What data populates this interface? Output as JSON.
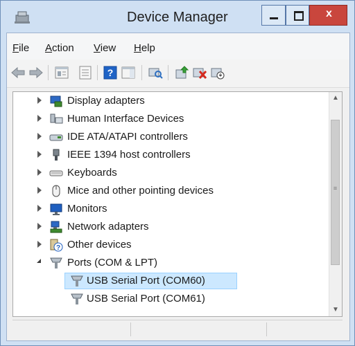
{
  "window": {
    "title": "Device Manager",
    "close_glyph": "x"
  },
  "menu": {
    "items": [
      {
        "label": "File",
        "underline": "F",
        "rest": "ile"
      },
      {
        "label": "Action",
        "underline": "A",
        "rest": "ction"
      },
      {
        "label": "View",
        "underline": "V",
        "rest": "iew"
      },
      {
        "label": "Help",
        "underline": "H",
        "rest": "elp"
      }
    ]
  },
  "toolbar": {
    "buttons": [
      "back-arrow-icon",
      "forward-arrow-icon",
      "properties-window-icon",
      "show-hidden-icon",
      "help-icon",
      "action-pane-icon",
      "scan-hardware-icon",
      "update-driver-icon",
      "uninstall-device-icon",
      "disable-device-icon"
    ]
  },
  "tree": {
    "items": [
      {
        "label": "Display adapters",
        "icon": "display-adapter-icon",
        "state": "collapsed",
        "level": 1
      },
      {
        "label": "Human Interface Devices",
        "icon": "hid-icon",
        "state": "collapsed",
        "level": 1
      },
      {
        "label": "IDE ATA/ATAPI controllers",
        "icon": "ide-controller-icon",
        "state": "collapsed",
        "level": 1
      },
      {
        "label": "IEEE 1394 host controllers",
        "icon": "ieee1394-icon",
        "state": "collapsed",
        "level": 1
      },
      {
        "label": "Keyboards",
        "icon": "keyboard-icon",
        "state": "collapsed",
        "level": 1
      },
      {
        "label": "Mice and other pointing devices",
        "icon": "mouse-icon",
        "state": "collapsed",
        "level": 1
      },
      {
        "label": "Monitors",
        "icon": "monitor-icon",
        "state": "collapsed",
        "level": 1
      },
      {
        "label": "Network adapters",
        "icon": "network-adapter-icon",
        "state": "collapsed",
        "level": 1
      },
      {
        "label": "Other devices",
        "icon": "unknown-device-icon",
        "state": "collapsed",
        "level": 1
      },
      {
        "label": "Ports (COM & LPT)",
        "icon": "port-icon",
        "state": "expanded",
        "level": 1
      },
      {
        "label": "USB Serial Port (COM60)",
        "icon": "serial-port-icon",
        "state": "leaf",
        "level": 2,
        "selected": true
      },
      {
        "label": "USB Serial Port (COM61)",
        "icon": "serial-port-icon",
        "state": "leaf",
        "level": 2
      }
    ]
  },
  "scrollbar": {
    "up_glyph": "▲",
    "down_glyph": "▼",
    "grip": "≡"
  },
  "colors": {
    "titlebar": "#cfe0f3",
    "close_button": "#c9463d",
    "selection": "#cce8ff"
  }
}
